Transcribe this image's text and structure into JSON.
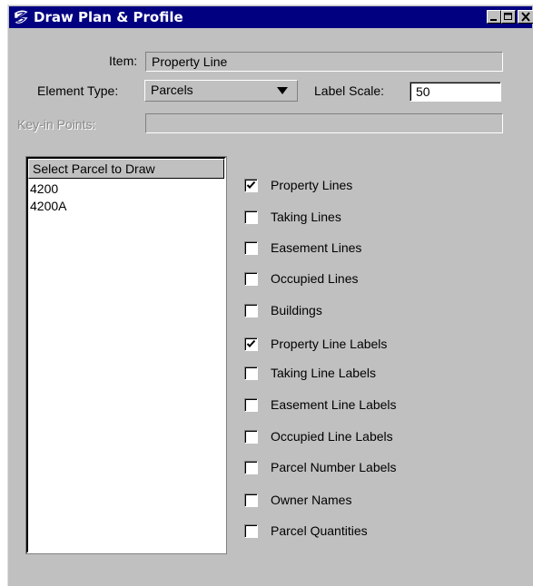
{
  "window": {
    "title": "Draw Plan & Profile"
  },
  "form": {
    "item_label": "Item:",
    "item_value": "Property Line",
    "element_type_label": "Element Type:",
    "element_type_value": "Parcels",
    "label_scale_label": "Label Scale:",
    "label_scale_value": "50",
    "keyin_label": "Key-in Points:",
    "keyin_value": ""
  },
  "parcel_list": {
    "header": "Select Parcel to Draw",
    "items": [
      "4200",
      "4200A"
    ]
  },
  "options": [
    {
      "label": "Property Lines",
      "checked": true
    },
    {
      "label": "Taking Lines",
      "checked": false
    },
    {
      "label": "Easement Lines",
      "checked": false
    },
    {
      "label": "Occupied Lines",
      "checked": false
    },
    {
      "label": "Buildings",
      "checked": false
    },
    {
      "label": "Property Line Labels",
      "checked": true
    },
    {
      "label": "Taking Line Labels",
      "checked": false
    },
    {
      "label": "Easement Line Labels",
      "checked": false
    },
    {
      "label": "Occupied Line Labels",
      "checked": false
    },
    {
      "label": "Parcel Number Labels",
      "checked": false
    },
    {
      "label": "Owner Names",
      "checked": false
    },
    {
      "label": "Parcel Quantities",
      "checked": false
    }
  ]
}
